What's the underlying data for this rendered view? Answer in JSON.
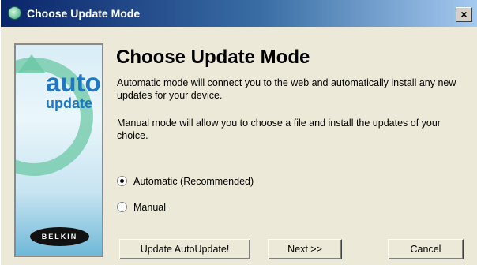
{
  "window": {
    "title": "Choose Update Mode",
    "close_label": "×"
  },
  "banner": {
    "logo_auto": "auto",
    "logo_update": "update",
    "brand": "BELKIN"
  },
  "content": {
    "heading": "Choose Update Mode",
    "automatic_description": "Automatic mode will connect you to the web and automatically install any new updates for your device.",
    "manual_description": "Manual mode will allow you to choose a file and install the updates of your choice."
  },
  "options": {
    "selected": "automatic",
    "automatic_label": "Automatic (Recommended)",
    "manual_label": "Manual"
  },
  "buttons": {
    "update_autoupdate": "Update AutoUpdate!",
    "next": "Next >>",
    "cancel": "Cancel"
  }
}
